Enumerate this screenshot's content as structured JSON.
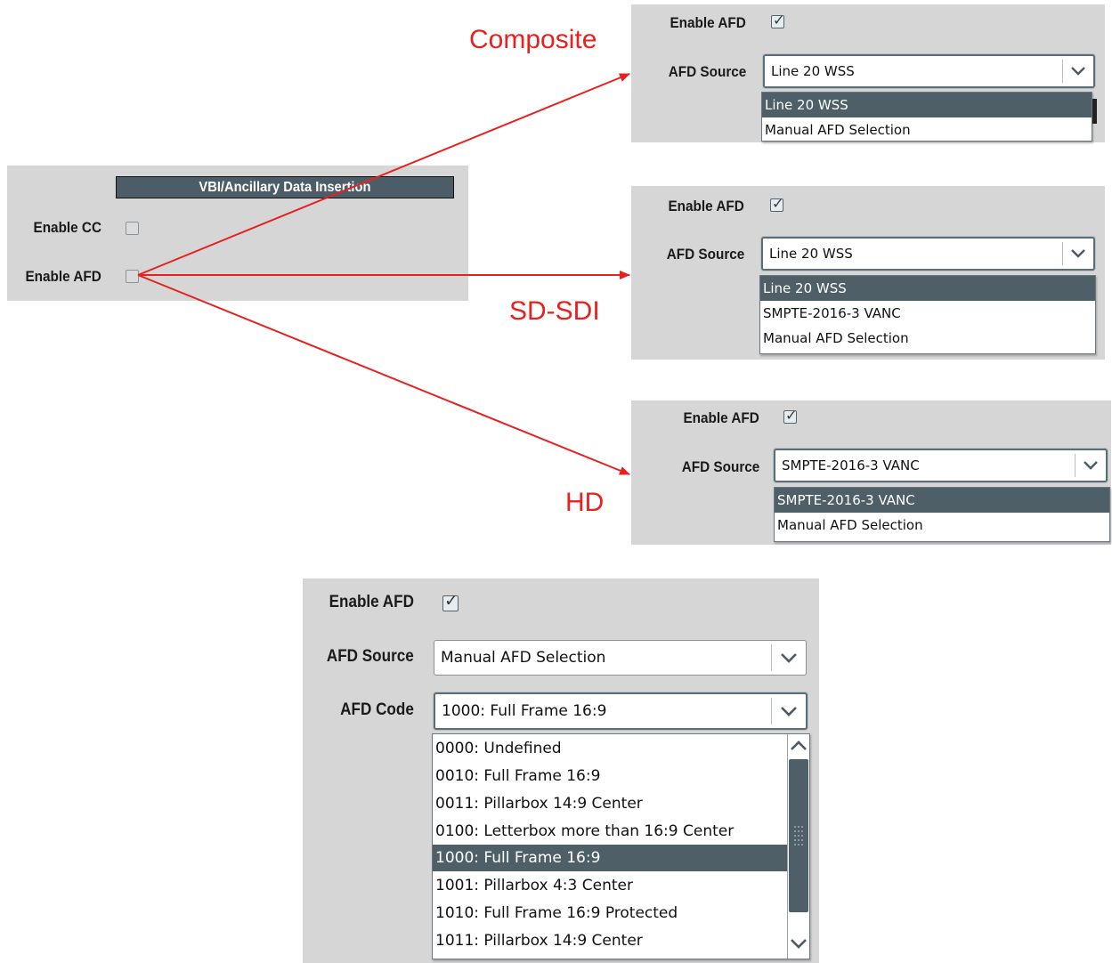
{
  "annotations": {
    "composite": "Composite",
    "sdsdi": "SD-SDI",
    "hd": "HD"
  },
  "colors": {
    "arrow": "#e8211e",
    "selection": "#4f5f68",
    "panel": "#d6d6d6"
  },
  "vbi_panel": {
    "header": "VBI/Ancillary Data Insertion",
    "enable_cc_label": "Enable CC",
    "enable_cc_checked": false,
    "enable_afd_label": "Enable AFD",
    "enable_afd_checked": false
  },
  "composite_panel": {
    "enable_afd_label": "Enable AFD",
    "enable_afd_checked": true,
    "afd_source_label": "AFD Source",
    "afd_source_value": "Line 20 WSS",
    "options": [
      "Line 20 WSS",
      "Manual AFD Selection"
    ],
    "selected_option": "Line 20 WSS"
  },
  "sdsdi_panel": {
    "enable_afd_label": "Enable AFD",
    "enable_afd_checked": true,
    "afd_source_label": "AFD Source",
    "afd_source_value": "Line 20 WSS",
    "options": [
      "Line 20 WSS",
      "SMPTE-2016-3 VANC",
      "Manual AFD Selection"
    ],
    "selected_option": "Line 20 WSS"
  },
  "hd_panel": {
    "enable_afd_label": "Enable AFD",
    "enable_afd_checked": true,
    "afd_source_label": "AFD Source",
    "afd_source_value": "SMPTE-2016-3 VANC",
    "options": [
      "SMPTE-2016-3 VANC",
      "Manual AFD Selection"
    ],
    "selected_option": "SMPTE-2016-3 VANC"
  },
  "manual_panel": {
    "enable_afd_label": "Enable AFD",
    "enable_afd_checked": true,
    "afd_source_label": "AFD Source",
    "afd_source_value": "Manual AFD Selection",
    "afd_code_label": "AFD Code",
    "afd_code_value": "1000: Full Frame 16:9",
    "options": [
      "0000: Undefined",
      "0010: Full Frame 16:9",
      "0011: Pillarbox 14:9 Center",
      "0100: Letterbox more than 16:9 Center",
      "1000: Full Frame 16:9",
      "1001: Pillarbox 4:3 Center",
      "1010: Full Frame 16:9 Protected",
      "1011: Pillarbox 14:9 Center"
    ],
    "selected_option": "1000: Full Frame 16:9"
  },
  "icons": {
    "checkbox_tick": "check-icon",
    "dropdown_arrow": "chevron-down-icon",
    "scroll_up": "chevron-up-icon",
    "scroll_down": "chevron-down-icon",
    "annotation_arrow": "arrow-icon"
  }
}
